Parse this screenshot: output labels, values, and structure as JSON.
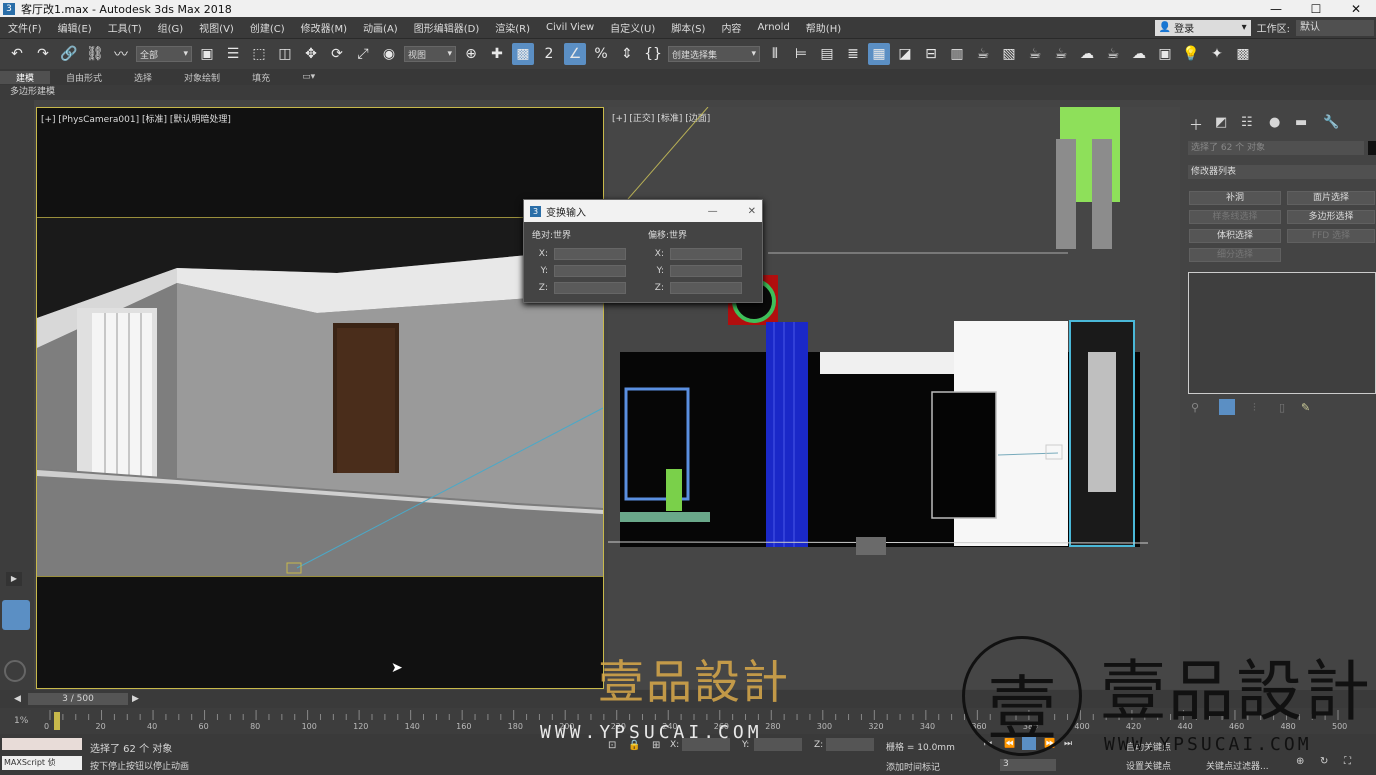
{
  "window": {
    "title": "客厅改1.max - Autodesk 3ds Max 2018",
    "icon": "3"
  },
  "window_controls": {
    "minimize": "—",
    "maximize": "☐",
    "close": "✕"
  },
  "menu": [
    "文件(F)",
    "编辑(E)",
    "工具(T)",
    "组(G)",
    "视图(V)",
    "创建(C)",
    "修改器(M)",
    "动画(A)",
    "图形编辑器(D)",
    "渲染(R)",
    "Civil View",
    "自定义(U)",
    "脚本(S)",
    "内容",
    "Arnold",
    "帮助(H)"
  ],
  "login": {
    "label": "登录",
    "icon": "user-icon"
  },
  "workspace": {
    "label": "工作区:",
    "value": "默认"
  },
  "toolbar": {
    "filter_select": "全部",
    "ref_coord_select": "视图",
    "selection_set_select": "创建选择集"
  },
  "ribbon": {
    "tabs": [
      "建模",
      "自由形式",
      "选择",
      "对象绘制",
      "填充"
    ],
    "active": "建模",
    "sub_label": "多边形建模"
  },
  "viewports": {
    "camera_label": "[+] [PhysCamera001] [标准] [默认明暗处理]",
    "front_label": "[+] [正交] [标准] [边面]"
  },
  "dialog": {
    "title": "变换输入",
    "abs_header": "绝对:世界",
    "off_header": "偏移:世界",
    "axes": [
      "X:",
      "Y:",
      "Z:"
    ]
  },
  "command_panel": {
    "selection_text": "选择了 62 个 对象",
    "modifier_list": "修改器列表",
    "buttons": [
      {
        "label": "补洞",
        "enabled": true
      },
      {
        "label": "面片选择",
        "enabled": true
      },
      {
        "label": "样条线选择",
        "enabled": false
      },
      {
        "label": "多边形选择",
        "enabled": true
      },
      {
        "label": "体积选择",
        "enabled": true
      },
      {
        "label": "FFD 选择",
        "enabled": false
      },
      {
        "label": "细分选择",
        "enabled": false
      }
    ]
  },
  "timebar": {
    "frame_display": "3 / 500"
  },
  "timeline": {
    "ticks": [
      "0",
      "20",
      "40",
      "60",
      "80",
      "100",
      "120",
      "140",
      "160",
      "180",
      "200",
      "220",
      "240",
      "260",
      "280",
      "300",
      "320",
      "340",
      "360",
      "380",
      "400",
      "420",
      "440",
      "460",
      "480",
      "500"
    ],
    "current_frame": 3
  },
  "status": {
    "maxscript_label": "MAXScript 侦",
    "line1": "选择了 62 个 对象",
    "line2": "按下停止按钮以停止动画",
    "grid": "栅格 = 10.0mm",
    "add_time_tag": "添加时间标记",
    "auto_key": "自动关键点",
    "set_key": "设置关键点",
    "key_filter": "关键点过滤器...",
    "x_label": "X:",
    "y_label": "Y:",
    "z_label": "Z:",
    "frame_field": "3"
  },
  "watermark": {
    "brand_cn": "壹品設計",
    "url_a": "WWW.YPSUCAI.COM",
    "url_b": "WWW.YPSUCAI.COM"
  },
  "colors": {
    "accent": "#5b8fc4",
    "viewport_border": "#c8b94b",
    "watermark": "#d9a94a"
  }
}
